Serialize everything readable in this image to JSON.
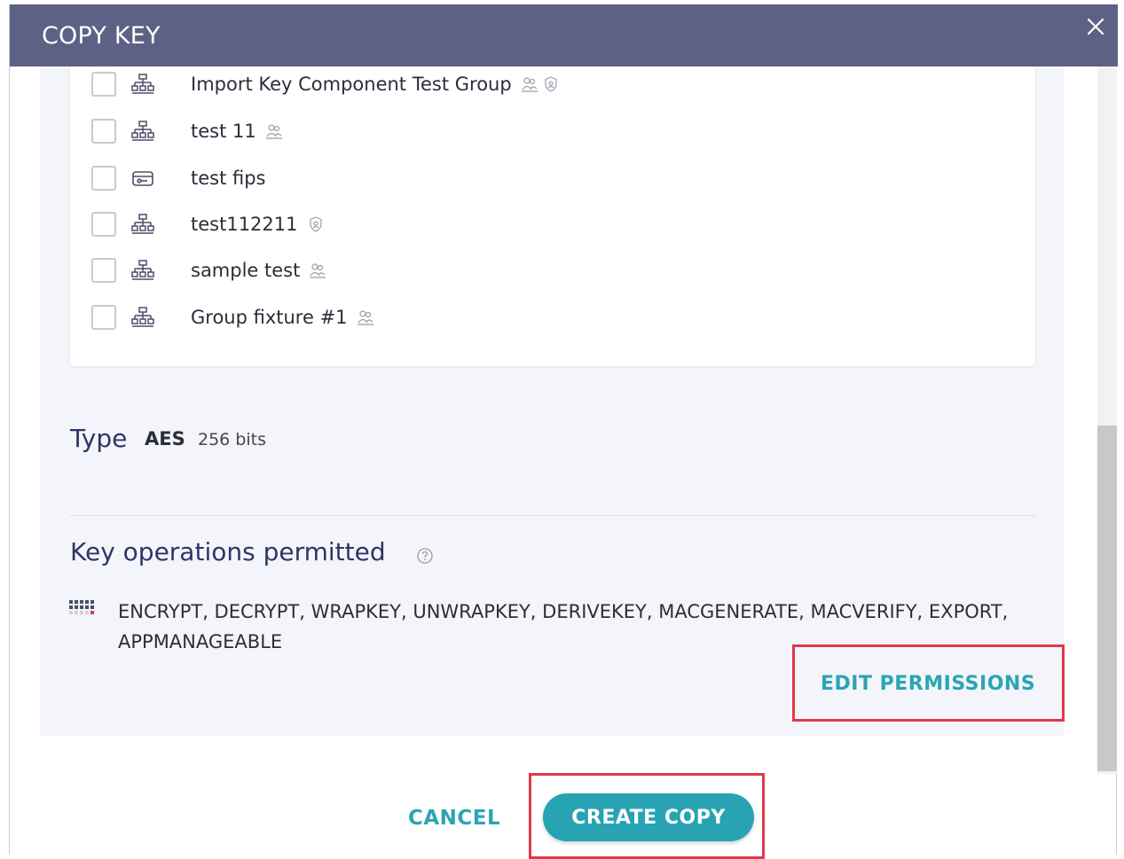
{
  "dialog": {
    "title": "COPY KEY",
    "close_icon": "close-icon"
  },
  "groups": [
    {
      "label": "Import Key Component Test Group",
      "icon": "group-hierarchy-icon",
      "badges": [
        "users-icon",
        "shield-icon"
      ]
    },
    {
      "label": "test 11",
      "icon": "group-hierarchy-icon",
      "badges": [
        "users-icon"
      ]
    },
    {
      "label": "test fips",
      "icon": "hsm-key-icon",
      "badges": []
    },
    {
      "label": "test112211",
      "icon": "group-hierarchy-icon",
      "badges": [
        "shield-icon"
      ]
    },
    {
      "label": "sample test",
      "icon": "group-hierarchy-icon",
      "badges": [
        "users-icon"
      ]
    },
    {
      "label": "Group fixture #1",
      "icon": "group-hierarchy-icon",
      "badges": [
        "users-icon"
      ]
    }
  ],
  "type": {
    "label": "Type",
    "value": "AES",
    "size": "256 bits"
  },
  "operations": {
    "title": "Key operations permitted",
    "text": "ENCRYPT, DECRYPT, WRAPKEY, UNWRAPKEY, DERIVEKEY, MACGENERATE, MACVERIFY, EXPORT, APPMANAGEABLE",
    "edit_label": "EDIT PERMISSIONS"
  },
  "footer": {
    "cancel_label": "CANCEL",
    "create_label": "CREATE COPY"
  },
  "colors": {
    "titlebar": "#5d6185",
    "accent": "#27a3b3",
    "highlight": "#e0394b"
  }
}
